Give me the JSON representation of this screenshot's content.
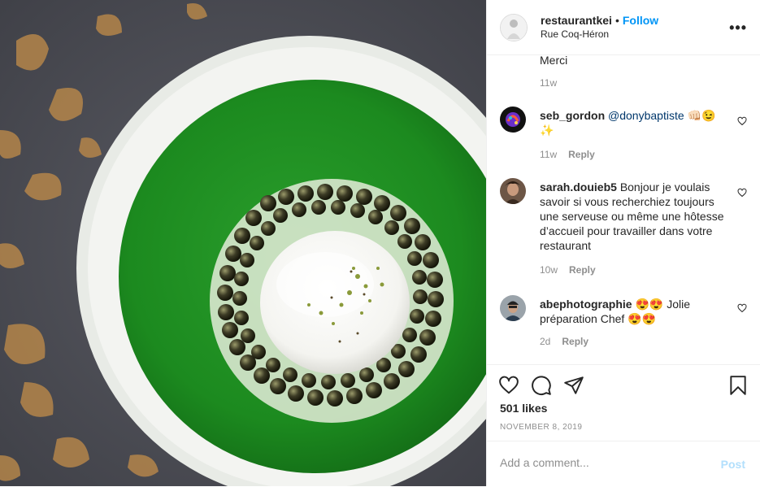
{
  "header": {
    "username": "restaurantkei",
    "separator": "•",
    "follow_label": "Follow",
    "location": "Rue Coq-Héron",
    "more_label": "•••"
  },
  "comments": [
    {
      "text": "Merci",
      "time": "11w"
    },
    {
      "username": "seb_gordon",
      "mention": "@donybaptiste",
      "text": "👊🏻😉✨",
      "time": "11w",
      "reply": "Reply"
    },
    {
      "username": "sarah.douieb5",
      "text": "Bonjour je voulais savoir si vous recherchiez toujours une serveuse ou même une hôtesse d’accueil pour travailler dans votre restaurant",
      "time": "10w",
      "reply": "Reply"
    },
    {
      "username": "abephotographie",
      "text": "😍😍 Jolie préparation Chef 😍😍",
      "time": "2d",
      "reply": "Reply"
    }
  ],
  "likes": "501 likes",
  "date": "NOVEMBER 8, 2019",
  "add_comment": {
    "placeholder": "Add a comment...",
    "post_label": "Post"
  },
  "colors": {
    "accent": "#0095f6",
    "post_disabled": "#b2dffc",
    "soup": "#1c8a1f",
    "secondary_text": "#8e8e8e"
  }
}
